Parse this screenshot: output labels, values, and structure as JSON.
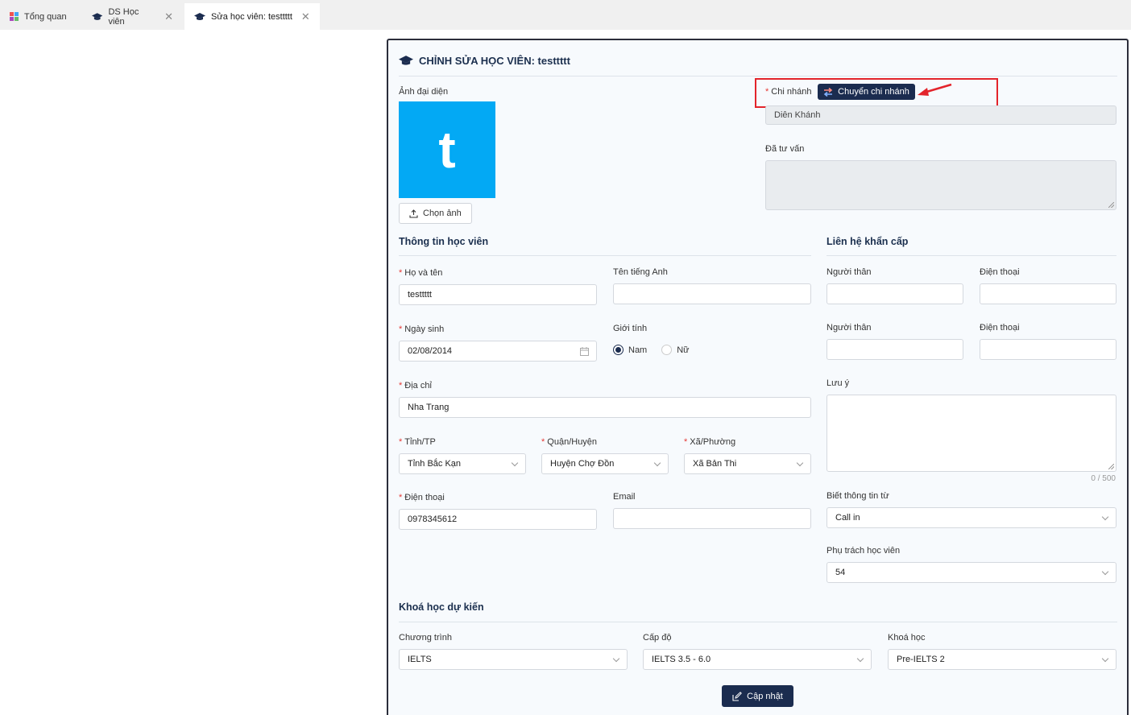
{
  "tabs": [
    {
      "label": "Tổng quan",
      "closable": false
    },
    {
      "label": "DS Học viên",
      "closable": true
    },
    {
      "label": "Sửa học viên: testtttt",
      "closable": true,
      "active": true
    }
  ],
  "form": {
    "title": "CHỈNH SỬA HỌC VIÊN: testtttt",
    "avatar": {
      "label": "Ảnh đại diện",
      "letter": "t",
      "color": "#03a9f4",
      "choose_label": "Chọn ảnh"
    },
    "branch": {
      "label": "Chi nhánh",
      "switch_label": "Chuyển chi nhánh",
      "value": "Diên Khánh"
    },
    "consulted": {
      "label": "Đã tư vấn",
      "value": ""
    },
    "student_info": {
      "section": "Thông tin học viên",
      "full_name": {
        "label": "Họ và tên",
        "value": "testtttt"
      },
      "english_name": {
        "label": "Tên tiếng Anh",
        "value": ""
      },
      "birthday": {
        "label": "Ngày sinh",
        "value": "02/08/2014"
      },
      "gender": {
        "label": "Giới tính",
        "options": [
          "Nam",
          "Nữ"
        ],
        "selected": "Nam"
      },
      "address": {
        "label": "Địa chỉ",
        "value": "Nha Trang"
      },
      "province": {
        "label": "Tỉnh/TP",
        "value": "Tỉnh Bắc Kạn"
      },
      "district": {
        "label": "Quận/Huyện",
        "value": "Huyện Chợ Đồn"
      },
      "ward": {
        "label": "Xã/Phường",
        "value": "Xã Bản Thi"
      },
      "phone": {
        "label": "Điện thoại",
        "value": "0978345612"
      },
      "email": {
        "label": "Email",
        "value": ""
      }
    },
    "emergency": {
      "section": "Liên hệ khẩn cấp",
      "relative_label": "Người thân",
      "phone_label": "Điện thoại",
      "note_label": "Lưu ý",
      "note_counter": "0 / 500",
      "source": {
        "label": "Biết thông tin từ",
        "value": "Call in"
      },
      "manager": {
        "label": "Phụ trách học viên",
        "value": "54"
      }
    },
    "course": {
      "section": "Khoá học dự kiến",
      "program": {
        "label": "Chương trình",
        "value": "IELTS"
      },
      "level": {
        "label": "Cấp độ",
        "value": "IELTS 3.5 - 6.0"
      },
      "class": {
        "label": "Khoá học",
        "value": "Pre-IELTS 2"
      }
    },
    "submit_label": "Cập nhật"
  },
  "colors": {
    "primary": "#1b2c4f",
    "required": "#e53935",
    "highlight": "#e3242b"
  }
}
